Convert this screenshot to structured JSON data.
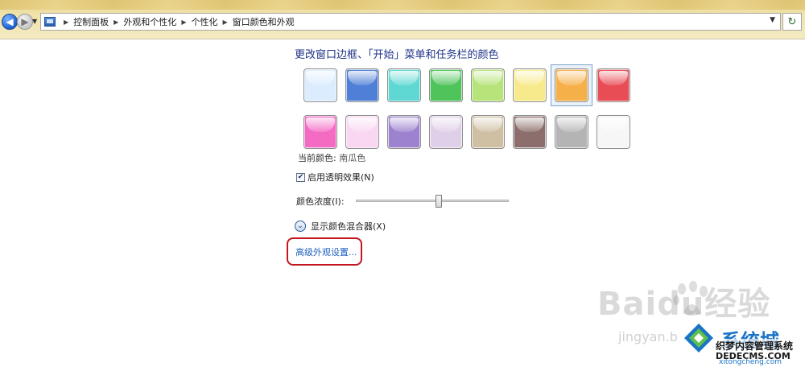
{
  "breadcrumbs": [
    "控制面板",
    "外观和个性化",
    "个性化",
    "窗口颜色和外观"
  ],
  "title": "更改窗口边框、「开始」菜单和任务栏的颜色",
  "swatches": [
    {
      "name": "sky",
      "color": "#dcecff"
    },
    {
      "name": "twilight",
      "color": "#4f7fd6"
    },
    {
      "name": "sea",
      "color": "#5fd8d4"
    },
    {
      "name": "leaf",
      "color": "#4fc45a"
    },
    {
      "name": "lime",
      "color": "#b6e37a"
    },
    {
      "name": "lightning",
      "color": "#f7ea8c"
    },
    {
      "name": "pumpkin",
      "color": "#f5b04a"
    },
    {
      "name": "ruby",
      "color": "#e84c55"
    },
    {
      "name": "fuchsia",
      "color": "#f46bc4"
    },
    {
      "name": "blush",
      "color": "#f9d6f2"
    },
    {
      "name": "violet",
      "color": "#9d83cf"
    },
    {
      "name": "lavender",
      "color": "#dfcfe8"
    },
    {
      "name": "taupe",
      "color": "#cfc0a4"
    },
    {
      "name": "chocolate",
      "color": "#8c6f6d"
    },
    {
      "name": "slate",
      "color": "#b4b4b4"
    },
    {
      "name": "frost",
      "color": "#f6f6f6"
    }
  ],
  "selected_swatch_index": 6,
  "current_color": {
    "label": "当前颜色:",
    "value": "南瓜色"
  },
  "transparency": {
    "label": "启用透明效果(N)",
    "checked": true
  },
  "intensity": {
    "label": "颜色浓度(I):",
    "value": 0.54
  },
  "mixer": {
    "label": "显示颜色混合器(X)"
  },
  "advanced_link": "高级外观设置...",
  "watermarks": {
    "baidu": "Baidu经验",
    "jingyan": "jingyan.b",
    "xitong": "系统城",
    "dede": "织梦内容管理系统",
    "dede_url": "DEDECMS.COM",
    "xitong_url": "xitongcheng.com"
  },
  "colors": {
    "title": "#1e3287",
    "link": "#1e5fbd",
    "highlight": "#c2171f"
  }
}
